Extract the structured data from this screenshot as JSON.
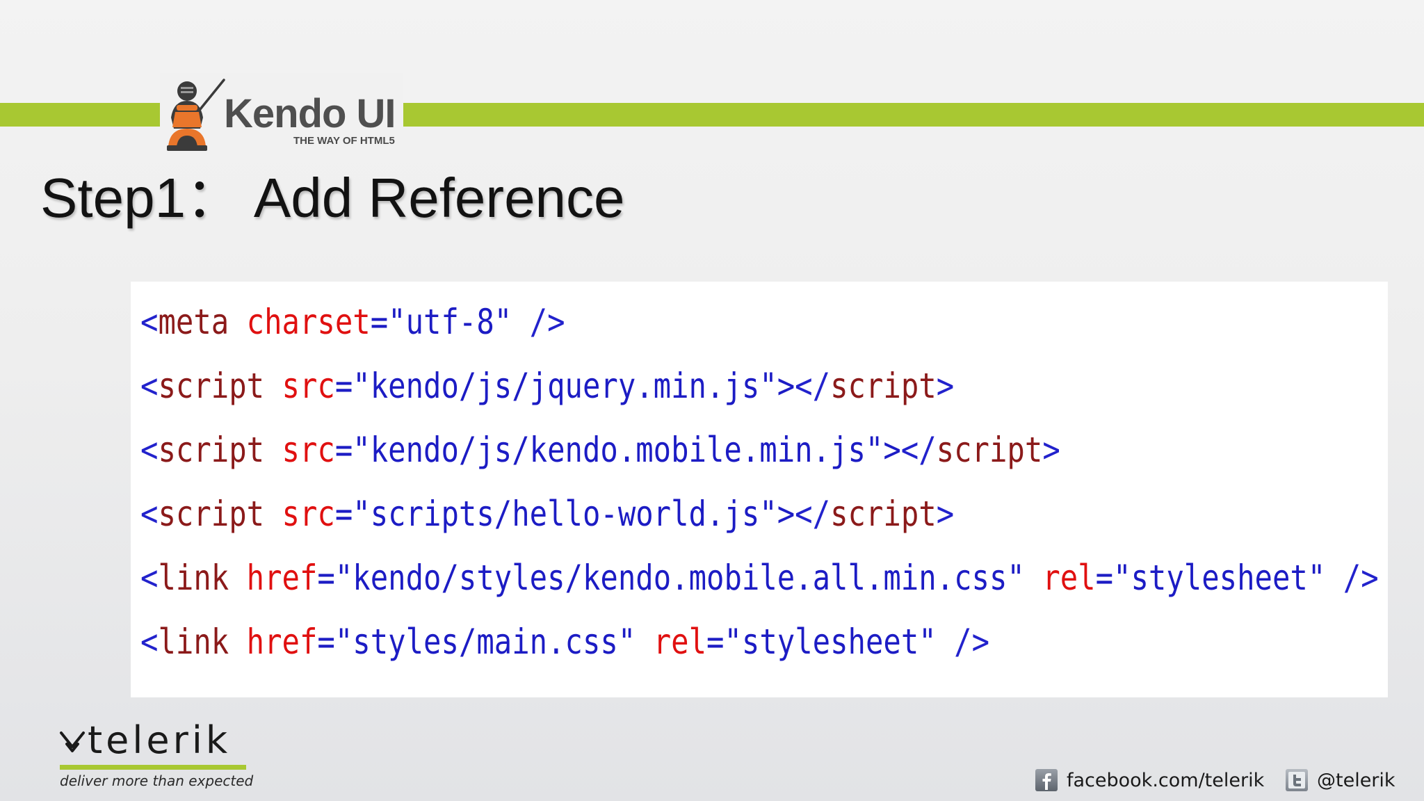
{
  "brand": {
    "name": "Kendo UI",
    "tagline": "THE WAY OF HTML5"
  },
  "slide": {
    "title": "Step1： Add Reference"
  },
  "code_lines": [
    [
      {
        "t": "<",
        "c": "punct"
      },
      {
        "t": "meta",
        "c": "tag"
      },
      {
        "t": " ",
        "c": "space"
      },
      {
        "t": "charset",
        "c": "attr"
      },
      {
        "t": "=\"utf-8\"",
        "c": "val"
      },
      {
        "t": " ",
        "c": "space"
      },
      {
        "t": "/>",
        "c": "punct"
      }
    ],
    [
      {
        "t": "<",
        "c": "punct"
      },
      {
        "t": "script",
        "c": "tag"
      },
      {
        "t": " ",
        "c": "space"
      },
      {
        "t": "src",
        "c": "attr"
      },
      {
        "t": "=\"kendo/js/jquery.min.js\">",
        "c": "val"
      },
      {
        "t": "</",
        "c": "punct"
      },
      {
        "t": "script",
        "c": "tag"
      },
      {
        "t": ">",
        "c": "punct"
      }
    ],
    [
      {
        "t": "<",
        "c": "punct"
      },
      {
        "t": "script",
        "c": "tag"
      },
      {
        "t": " ",
        "c": "space"
      },
      {
        "t": "src",
        "c": "attr"
      },
      {
        "t": "=\"kendo/js/kendo.mobile.min.js\">",
        "c": "val"
      },
      {
        "t": "</",
        "c": "punct"
      },
      {
        "t": "script",
        "c": "tag"
      },
      {
        "t": ">",
        "c": "punct"
      }
    ],
    [
      {
        "t": "<",
        "c": "punct"
      },
      {
        "t": "script",
        "c": "tag"
      },
      {
        "t": " ",
        "c": "space"
      },
      {
        "t": "src",
        "c": "attr"
      },
      {
        "t": "=\"scripts/hello-world.js\">",
        "c": "val"
      },
      {
        "t": "</",
        "c": "punct"
      },
      {
        "t": "script",
        "c": "tag"
      },
      {
        "t": ">",
        "c": "punct"
      }
    ],
    [
      {
        "t": "<",
        "c": "punct"
      },
      {
        "t": "link",
        "c": "tag"
      },
      {
        "t": " ",
        "c": "space"
      },
      {
        "t": "href",
        "c": "attr"
      },
      {
        "t": "=\"kendo/styles/kendo.mobile.all.min.css\"",
        "c": "val"
      },
      {
        "t": " ",
        "c": "space"
      },
      {
        "t": "rel",
        "c": "attr"
      },
      {
        "t": "=\"stylesheet\"",
        "c": "val"
      },
      {
        "t": " ",
        "c": "space"
      },
      {
        "t": "/>",
        "c": "punct"
      }
    ],
    [
      {
        "t": "<",
        "c": "punct"
      },
      {
        "t": "link",
        "c": "tag"
      },
      {
        "t": " ",
        "c": "space"
      },
      {
        "t": "href",
        "c": "attr"
      },
      {
        "t": "=\"styles/main.css\"",
        "c": "val"
      },
      {
        "t": " ",
        "c": "space"
      },
      {
        "t": "rel",
        "c": "attr"
      },
      {
        "t": "=\"stylesheet\"",
        "c": "val"
      },
      {
        "t": " ",
        "c": "space"
      },
      {
        "t": "/>",
        "c": "punct"
      }
    ]
  ],
  "footer": {
    "company": "telerik",
    "company_tagline": "deliver more than expected",
    "facebook": {
      "icon": "facebook-icon",
      "label": "facebook.com/telerik"
    },
    "twitter": {
      "icon": "twitter-icon",
      "label": "@telerik"
    }
  },
  "colors": {
    "accent_green": "#a8c832",
    "code_tag": "#8b1a1a",
    "code_attr": "#e01010",
    "code_value": "#1c1cc4"
  }
}
